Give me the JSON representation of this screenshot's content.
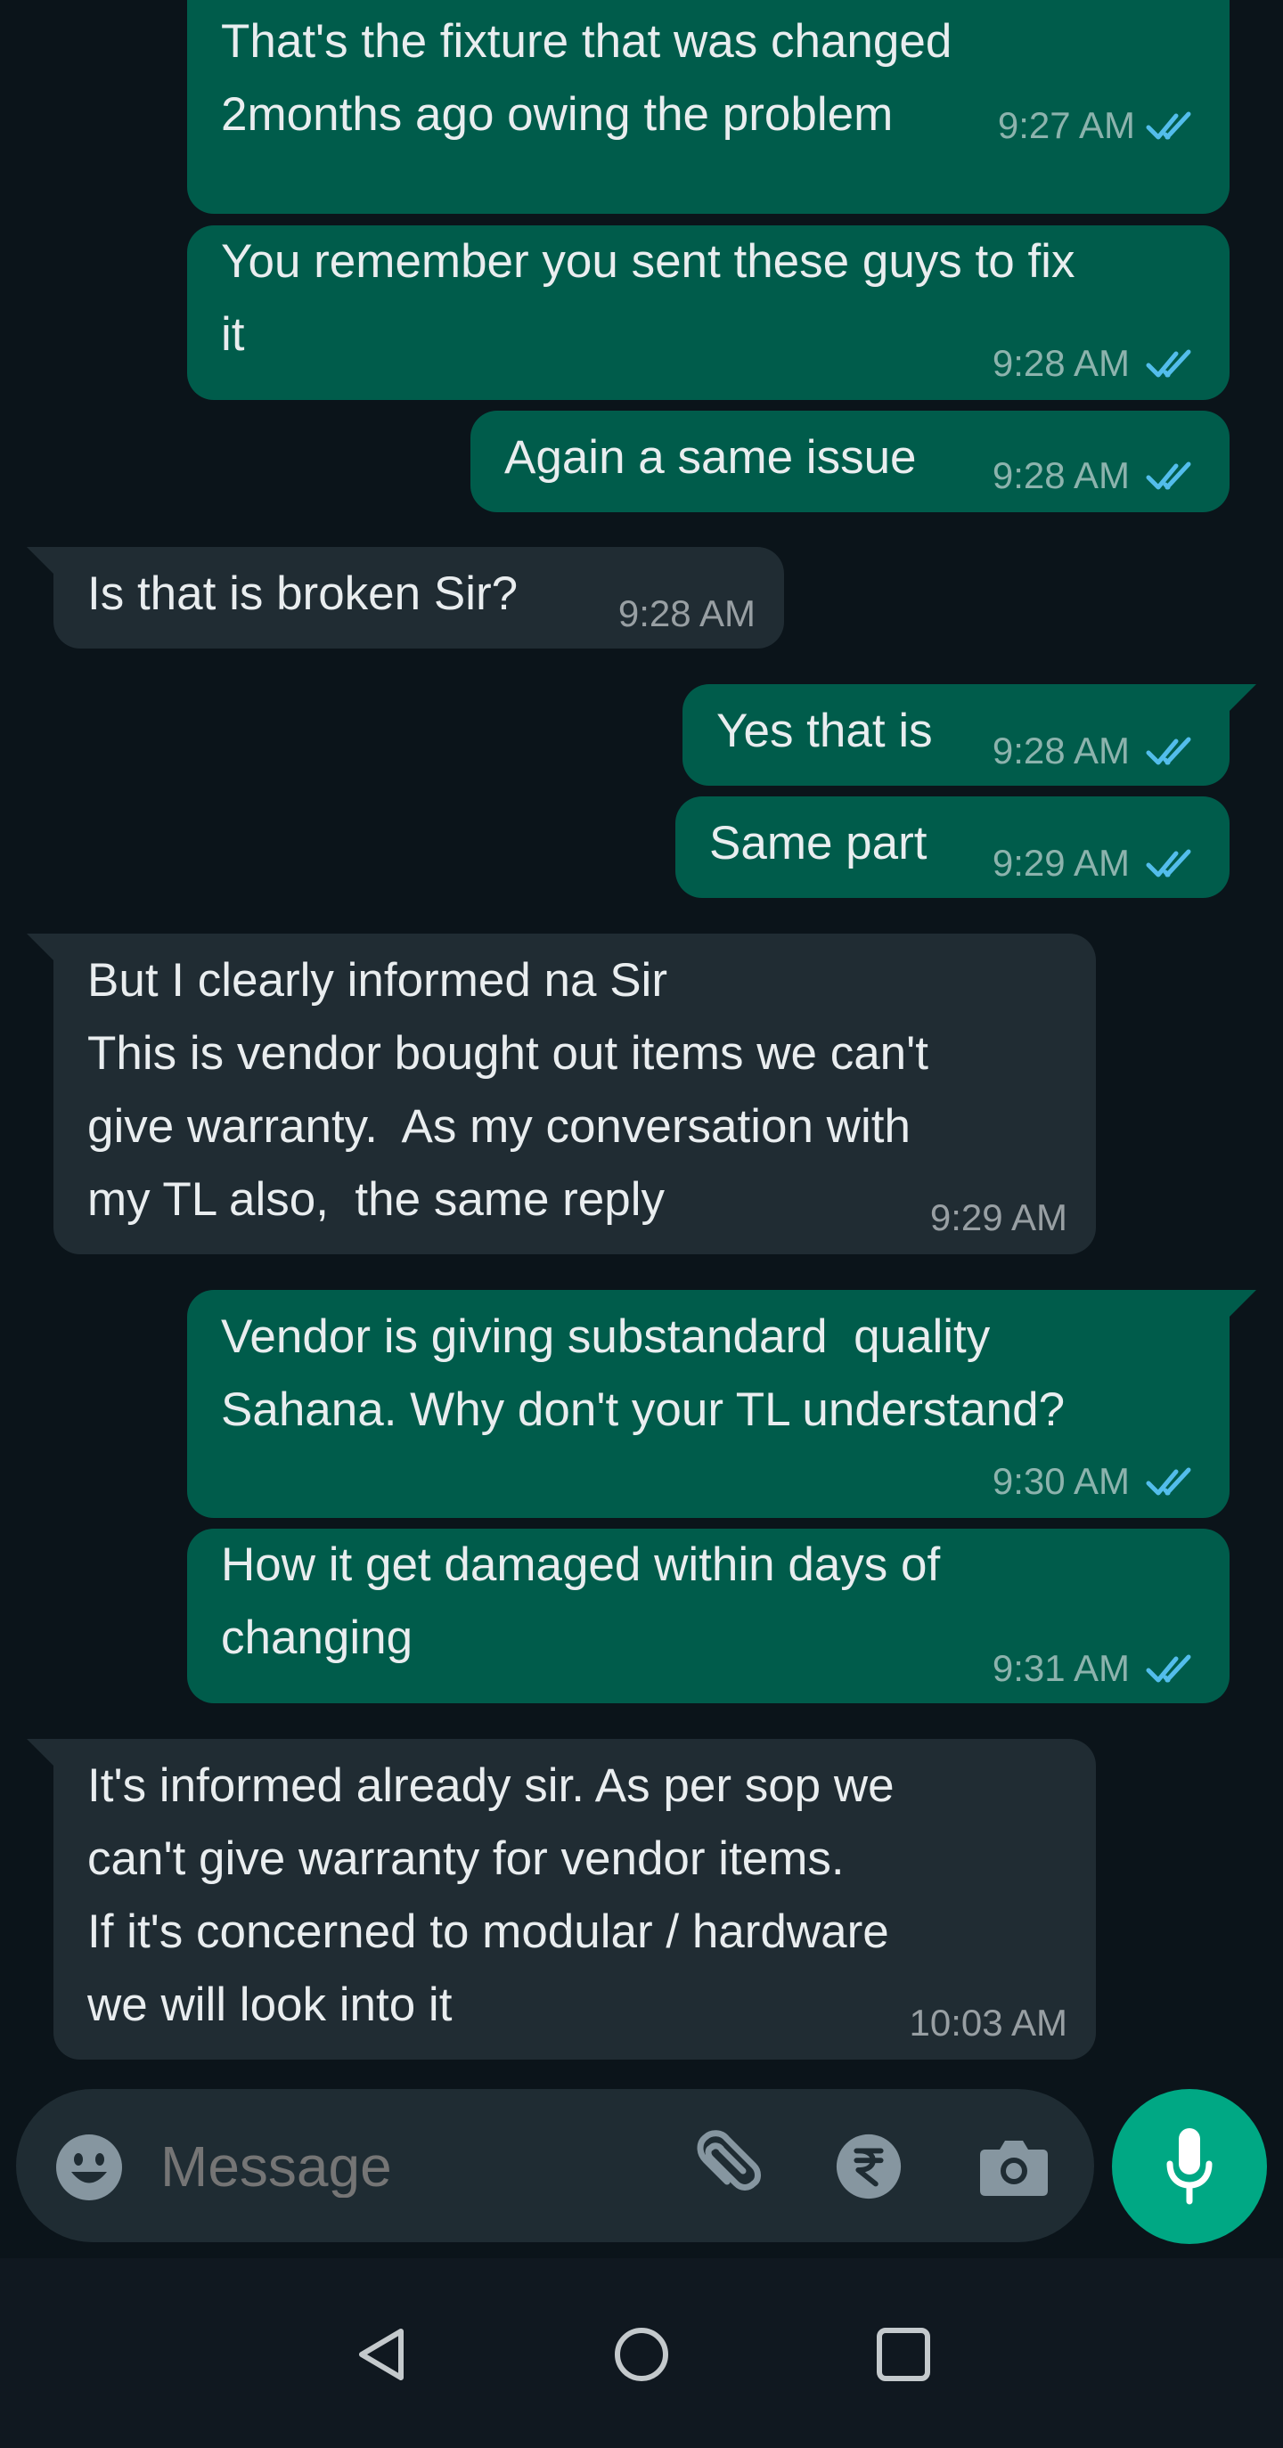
{
  "messages": [
    {
      "direction": "outgoing",
      "text": "That's the fixture that was changed\n2months ago owing the problem",
      "time": "9:27 AM",
      "status": "read"
    },
    {
      "direction": "outgoing",
      "text": "You remember you sent these guys to fix\nit",
      "time": "9:28 AM",
      "status": "read"
    },
    {
      "direction": "outgoing",
      "text": "Again a same issue",
      "time": "9:28 AM",
      "status": "read"
    },
    {
      "direction": "incoming",
      "text": "Is that is broken Sir?",
      "time": "9:28 AM"
    },
    {
      "direction": "outgoing",
      "text": "Yes that is",
      "time": "9:28 AM",
      "status": "read"
    },
    {
      "direction": "outgoing",
      "text": "Same part",
      "time": "9:29 AM",
      "status": "read"
    },
    {
      "direction": "incoming",
      "text": "But I clearly informed na Sir\nThis is vendor bought out items we can't\ngive warranty.  As my conversation with\nmy TL also,  the same reply",
      "time": "9:29 AM"
    },
    {
      "direction": "outgoing",
      "text": "Vendor is giving substandard  quality\nSahana. Why don't your TL understand?",
      "time": "9:30 AM",
      "status": "read"
    },
    {
      "direction": "outgoing",
      "text": "How it get damaged within days of\nchanging",
      "time": "9:31 AM",
      "status": "read"
    },
    {
      "direction": "incoming",
      "text": "It's informed already sir. As per sop we\ncan't give warranty for vendor items.\nIf it's concerned to modular / hardware\nwe will look into it",
      "time": "10:03 AM"
    }
  ],
  "composer": {
    "placeholder": "Message",
    "icons": [
      "emoji-icon",
      "attach-icon",
      "rupee-payment-icon",
      "camera-icon",
      "mic-icon"
    ]
  },
  "navigation": {
    "icons": [
      "back-icon",
      "home-icon",
      "recents-icon"
    ]
  },
  "colors": {
    "background": "#0b141a",
    "outgoing_bubble": "#005c4b",
    "incoming_bubble": "#202c33",
    "read_ticks": "#53bdeb",
    "accent": "#00a884"
  }
}
